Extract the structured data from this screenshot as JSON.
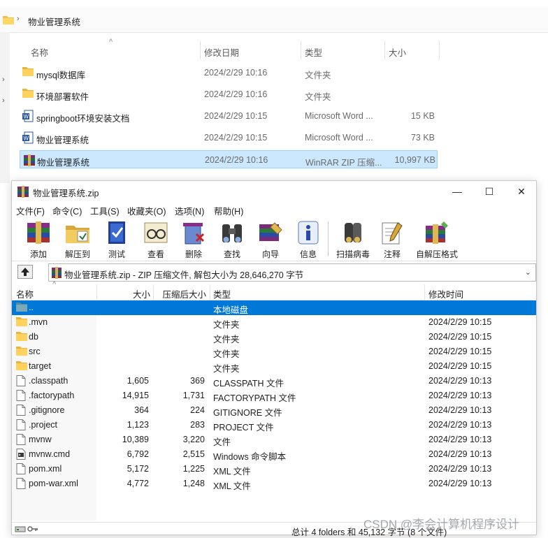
{
  "explorer": {
    "breadcrumb": "物业管理系统",
    "columns": {
      "name": "名称",
      "date": "修改日期",
      "type": "类型",
      "size": "大小"
    },
    "files": [
      {
        "icon": "folder-icon",
        "name": "mysql数据库",
        "date": "2024/2/29 10:16",
        "type": "文件夹",
        "size": ""
      },
      {
        "icon": "folder-icon",
        "name": "环境部署软件",
        "date": "2024/2/29 10:16",
        "type": "文件夹",
        "size": ""
      },
      {
        "icon": "word-doc-icon",
        "name": "springboot环境安装文档",
        "date": "2024/2/29 10:15",
        "type": "Microsoft Word ...",
        "size": "15 KB"
      },
      {
        "icon": "word-doc-icon",
        "name": "物业管理系统",
        "date": "2024/2/29 10:15",
        "type": "Microsoft Word ...",
        "size": "73 KB"
      },
      {
        "icon": "winrar-archive-icon",
        "name": "物业管理系统",
        "date": "2024/2/29 10:16",
        "type": "WinRAR ZIP 压缩...",
        "size": "10,997 KB",
        "selected": true
      }
    ]
  },
  "winrar": {
    "title": "物业管理系统.zip",
    "window_buttons": {
      "minimize": "—",
      "maximize": "☐",
      "close": "✕"
    },
    "menu": [
      "文件(F)",
      "命令(C)",
      "工具(S)",
      "收藏夹(O)",
      "选项(N)",
      "帮助(H)"
    ],
    "toolbar": [
      "添加",
      "解压到",
      "测试",
      "查看",
      "删除",
      "查找",
      "向导",
      "信息",
      "扫描病毒",
      "注释",
      "自解压格式"
    ],
    "path": "物业管理系统.zip - ZIP 压缩文件, 解包大小为 28,646,270 字节",
    "columns": {
      "name": "名称",
      "size": "大小",
      "packed": "压缩后大小",
      "type": "类型",
      "modified": "修改时间"
    },
    "rows": [
      {
        "kind": "up",
        "name": "..",
        "size": "",
        "packed": "",
        "type": "本地磁盘",
        "modified": "",
        "selected": true
      },
      {
        "kind": "folder",
        "name": ".mvn",
        "size": "",
        "packed": "",
        "type": "文件夹",
        "modified": "2024/2/29 10:15"
      },
      {
        "kind": "folder",
        "name": "db",
        "size": "",
        "packed": "",
        "type": "文件夹",
        "modified": "2024/2/29 10:15"
      },
      {
        "kind": "folder",
        "name": "src",
        "size": "",
        "packed": "",
        "type": "文件夹",
        "modified": "2024/2/29 10:15"
      },
      {
        "kind": "folder",
        "name": "target",
        "size": "",
        "packed": "",
        "type": "文件夹",
        "modified": "2024/2/29 10:15"
      },
      {
        "kind": "file",
        "name": ".classpath",
        "size": "1,605",
        "packed": "369",
        "type": "CLASSPATH 文件",
        "modified": "2024/2/29 10:13"
      },
      {
        "kind": "file",
        "name": ".factorypath",
        "size": "14,915",
        "packed": "1,731",
        "type": "FACTORYPATH 文件",
        "modified": "2024/2/29 10:13"
      },
      {
        "kind": "file",
        "name": ".gitignore",
        "size": "364",
        "packed": "224",
        "type": "GITIGNORE 文件",
        "modified": "2024/2/29 10:13"
      },
      {
        "kind": "file",
        "name": ".project",
        "size": "1,123",
        "packed": "283",
        "type": "PROJECT 文件",
        "modified": "2024/2/29 10:13"
      },
      {
        "kind": "file",
        "name": "mvnw",
        "size": "10,389",
        "packed": "3,220",
        "type": "文件",
        "modified": "2024/2/29 10:13"
      },
      {
        "kind": "cmd",
        "name": "mvnw.cmd",
        "size": "6,792",
        "packed": "2,515",
        "type": "Windows 命令脚本",
        "modified": "2024/2/29 10:13"
      },
      {
        "kind": "file",
        "name": "pom.xml",
        "size": "5,172",
        "packed": "1,225",
        "type": "XML 文件",
        "modified": "2024/2/29 10:13"
      },
      {
        "kind": "file",
        "name": "pom-war.xml",
        "size": "4,772",
        "packed": "1,248",
        "type": "XML 文件",
        "modified": "2024/2/29 10:13"
      }
    ],
    "status": "总计 4 folders 和 45,132 字节 (8 个文件)"
  },
  "watermark": "CSDN @李会计算机程序设计"
}
